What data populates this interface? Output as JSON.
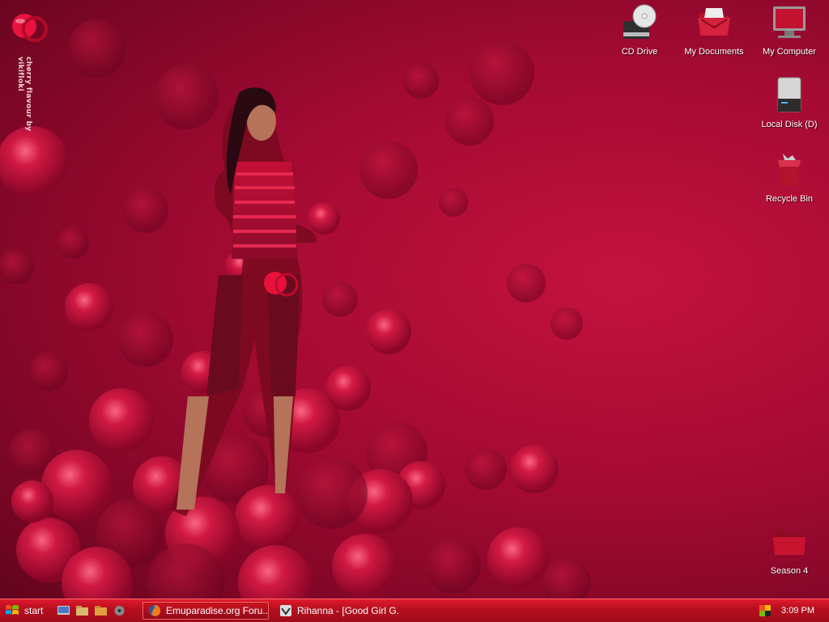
{
  "brand": {
    "text": "cherry flavour by vikifloki"
  },
  "desktop_icons": [
    {
      "id": "cd-drive",
      "label": "CD Drive"
    },
    {
      "id": "my-documents",
      "label": "My Documents"
    },
    {
      "id": "my-computer",
      "label": "My Computer"
    },
    {
      "id": "local-disk",
      "label": "Local Disk (D)"
    },
    {
      "id": "recycle-bin",
      "label": "Recycle Bin"
    },
    {
      "id": "season-4",
      "label": "Season 4"
    }
  ],
  "taskbar": {
    "start_label": "start",
    "quick_launch": [
      "show-desktop-icon",
      "explorer-icon",
      "folder-icon",
      "media-icon"
    ],
    "tasks": [
      {
        "title": "Emuparadise.org Foru...",
        "icon": "firefox-icon",
        "active": true
      },
      {
        "title": "Rihanna - [Good Girl G...",
        "icon": "winamp-icon",
        "active": false
      }
    ],
    "clock": "3:09 PM"
  },
  "colors": {
    "accent": "#c4123e",
    "taskbar": "#b80f1f",
    "text": "#ffffff"
  }
}
